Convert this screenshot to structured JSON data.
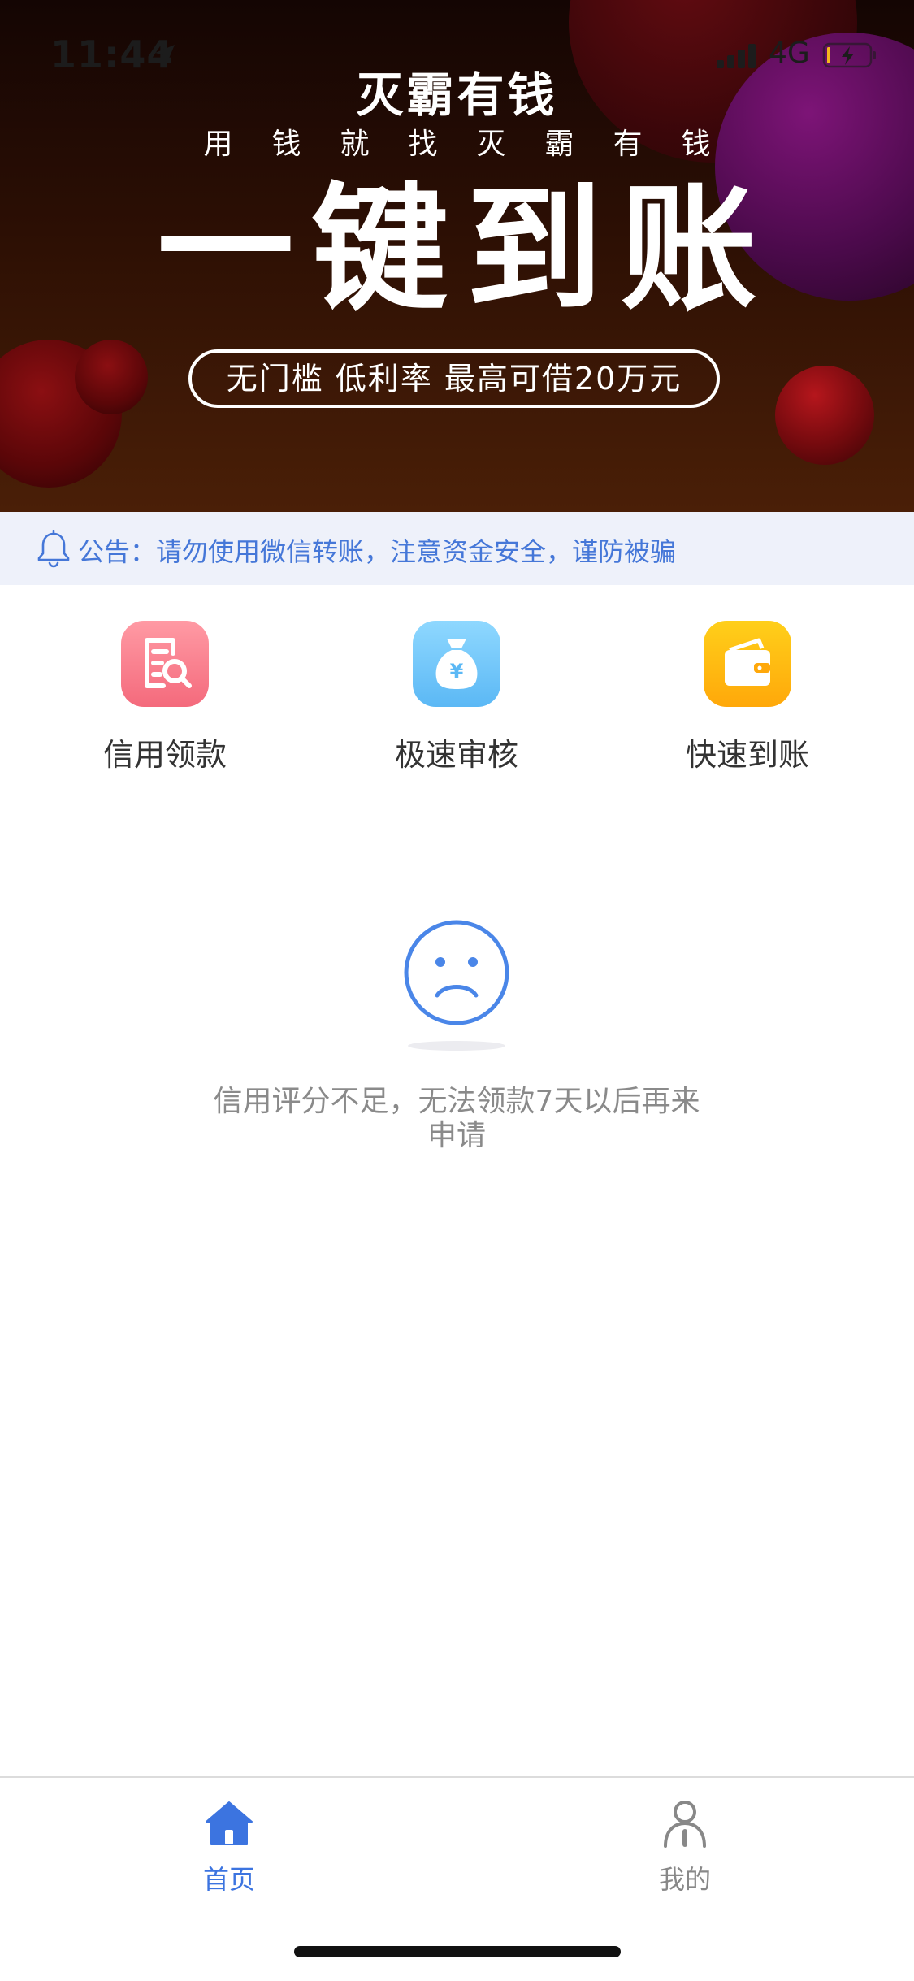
{
  "status_bar": {
    "time": "11:44",
    "network": "4G"
  },
  "banner": {
    "app_name": "灭霸有钱",
    "slogan": "用钱就找灭霸有钱",
    "headline": "一键到账",
    "pill_text": "无门槛 低利率 最高可借20万元"
  },
  "notice": {
    "text": "公告：请勿使用微信转账，注意资金安全，谨防被骗",
    "icon": "bell-icon"
  },
  "features": [
    {
      "label": "信用领款",
      "icon": "document-search-icon",
      "color": "#f46a7c"
    },
    {
      "label": "极速审核",
      "icon": "money-bag-icon",
      "color": "#5bb8f5"
    },
    {
      "label": "快速到账",
      "icon": "wallet-icon",
      "color": "#ffa80a"
    }
  ],
  "empty_state": {
    "icon": "sad-face-icon",
    "message": "信用评分不足，无法领款7天以后再来申请"
  },
  "tab_bar": {
    "tabs": [
      {
        "label": "首页",
        "icon": "home-icon",
        "active": true
      },
      {
        "label": "我的",
        "icon": "person-icon",
        "active": false
      }
    ],
    "active_color": "#3c74e0",
    "inactive_color": "#888888"
  }
}
